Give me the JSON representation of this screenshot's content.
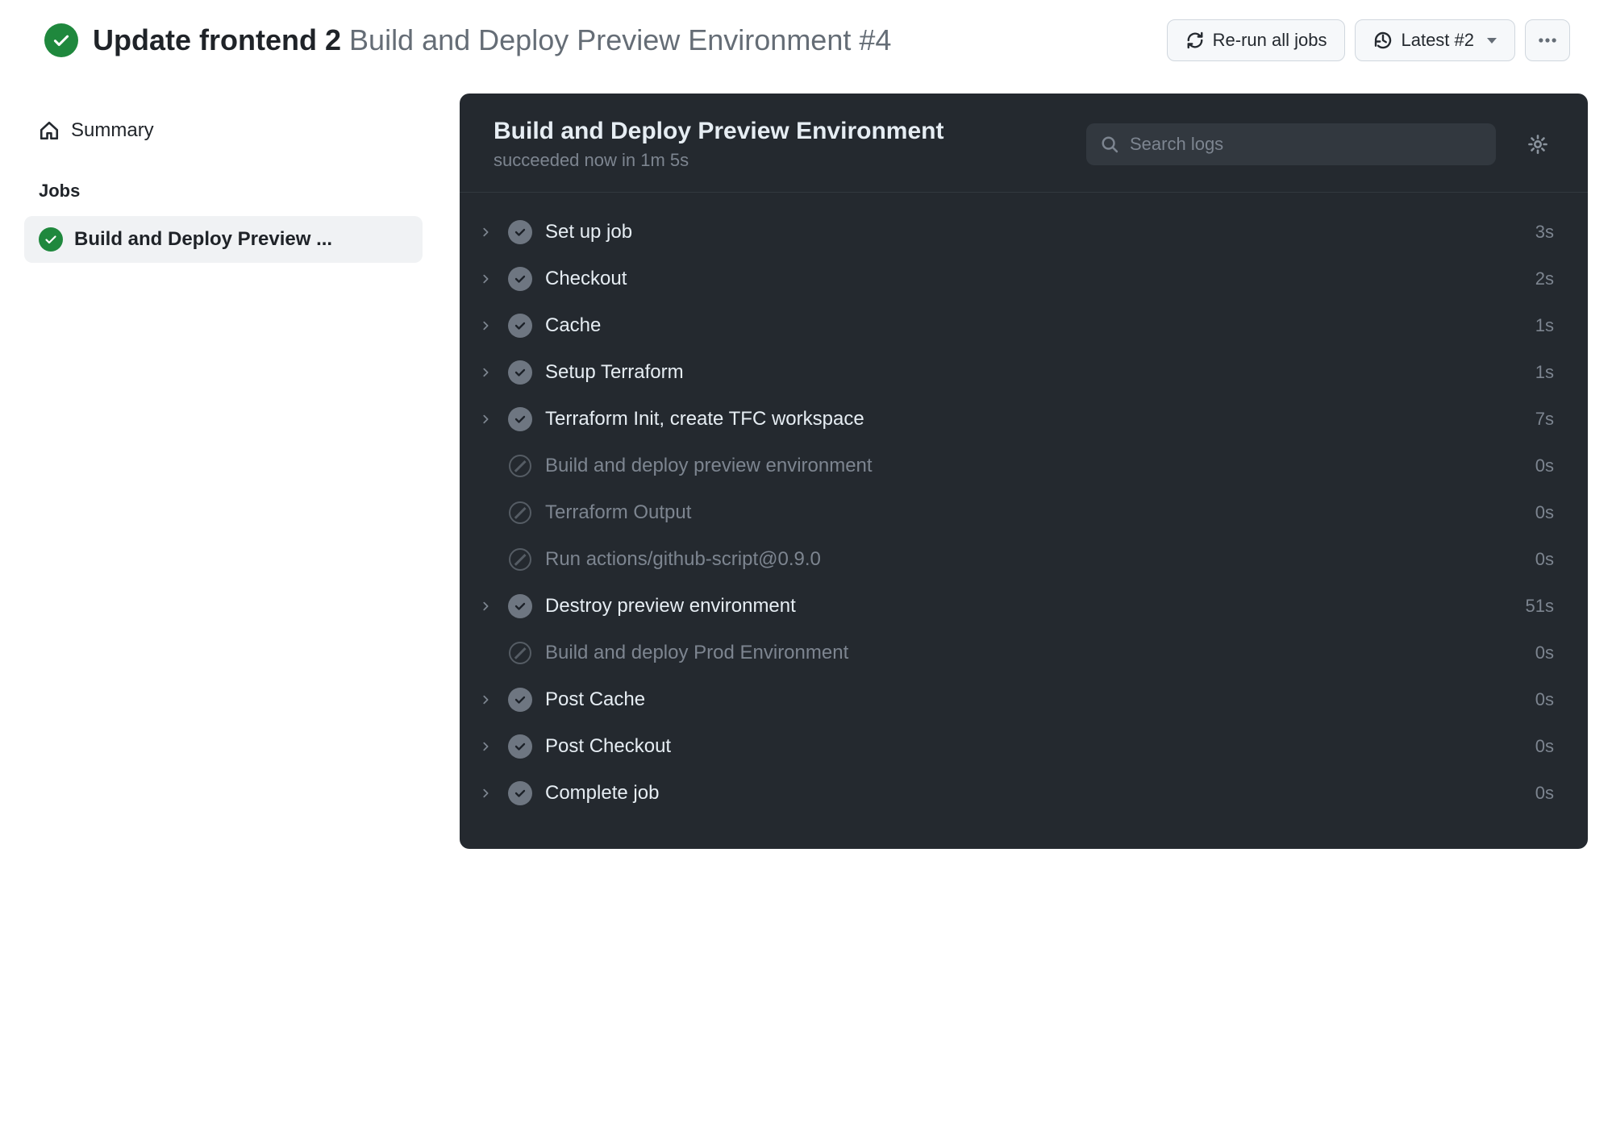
{
  "header": {
    "title_bold": "Update frontend 2",
    "title_rest": "Build and Deploy Preview Environment #4",
    "rerun_label": "Re-run all jobs",
    "latest_label": "Latest #2"
  },
  "sidebar": {
    "summary_label": "Summary",
    "jobs_heading": "Jobs",
    "job_label": "Build and Deploy Preview ..."
  },
  "log": {
    "title": "Build and Deploy Preview Environment",
    "subtitle": "succeeded now in 1m 5s",
    "search_placeholder": "Search logs"
  },
  "steps": [
    {
      "label": "Set up job",
      "duration": "3s",
      "status": "success",
      "expandable": true
    },
    {
      "label": "Checkout",
      "duration": "2s",
      "status": "success",
      "expandable": true
    },
    {
      "label": "Cache",
      "duration": "1s",
      "status": "success",
      "expandable": true
    },
    {
      "label": "Setup Terraform",
      "duration": "1s",
      "status": "success",
      "expandable": true
    },
    {
      "label": "Terraform Init, create TFC workspace",
      "duration": "7s",
      "status": "success",
      "expandable": true
    },
    {
      "label": "Build and deploy preview environment",
      "duration": "0s",
      "status": "skipped",
      "expandable": false
    },
    {
      "label": "Terraform Output",
      "duration": "0s",
      "status": "skipped",
      "expandable": false
    },
    {
      "label": "Run actions/github-script@0.9.0",
      "duration": "0s",
      "status": "skipped",
      "expandable": false
    },
    {
      "label": "Destroy preview environment",
      "duration": "51s",
      "status": "success",
      "expandable": true
    },
    {
      "label": "Build and deploy Prod Environment",
      "duration": "0s",
      "status": "skipped",
      "expandable": false
    },
    {
      "label": "Post Cache",
      "duration": "0s",
      "status": "success",
      "expandable": true
    },
    {
      "label": "Post Checkout",
      "duration": "0s",
      "status": "success",
      "expandable": true
    },
    {
      "label": "Complete job",
      "duration": "0s",
      "status": "success",
      "expandable": true
    }
  ]
}
